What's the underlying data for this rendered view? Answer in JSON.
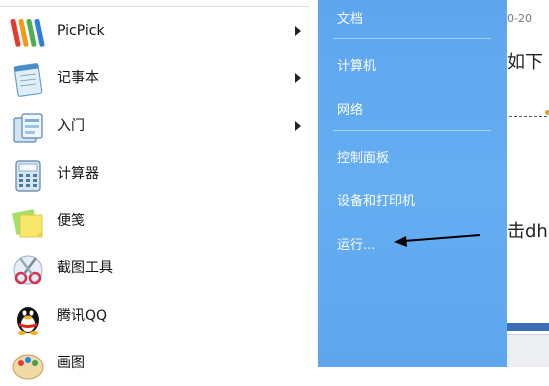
{
  "programs": [
    {
      "label": "PicPick",
      "icon": "picpick-icon",
      "has_submenu": true
    },
    {
      "label": "记事本",
      "icon": "notepad-icon",
      "has_submenu": true
    },
    {
      "label": "入门",
      "icon": "getting-started-icon",
      "has_submenu": true
    },
    {
      "label": "计算器",
      "icon": "calculator-icon",
      "has_submenu": false
    },
    {
      "label": "便笺",
      "icon": "sticky-notes-icon",
      "has_submenu": false
    },
    {
      "label": "截图工具",
      "icon": "snipping-tool-icon",
      "has_submenu": false
    },
    {
      "label": "腾讯QQ",
      "icon": "qq-penguin-icon",
      "has_submenu": false
    },
    {
      "label": "画图",
      "icon": "paint-icon",
      "has_submenu": false
    }
  ],
  "right_pane": {
    "documents": "文档",
    "computer": "计算机",
    "network": "网络",
    "control_panel": "控制面板",
    "devices_printers": "设备和打印机",
    "run": "运行..."
  },
  "background_document": {
    "date_fragment": "0-20",
    "text_line1": "如下",
    "text_line2": "击dh"
  },
  "colors": {
    "right_pane_blue": "#62aaf0",
    "annotation_arrow": "#000000"
  }
}
